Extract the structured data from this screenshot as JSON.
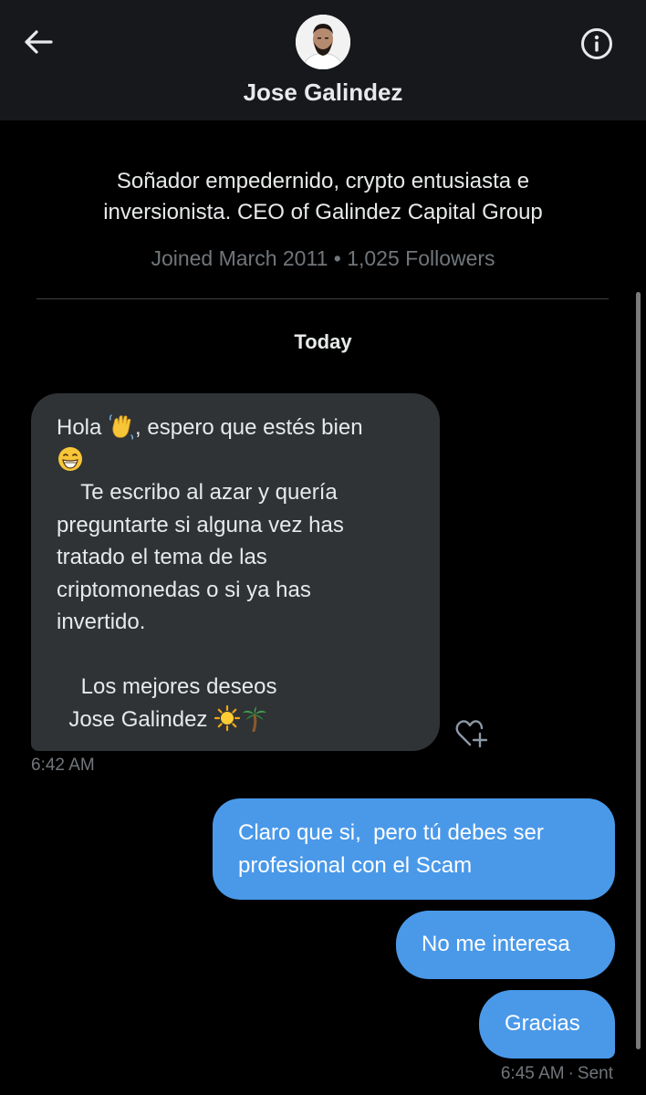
{
  "header": {
    "name": "Jose Galindez",
    "back_icon": "arrow-left-icon",
    "info_icon": "info-circle-icon"
  },
  "profile": {
    "bio_line1": "Soñador empedernido, crypto entusiasta e",
    "bio_line2": "inversionista. CEO of Galindez Capital Group",
    "joined": "Joined March 2011",
    "separator": "•",
    "followers": "1,025 Followers"
  },
  "conversation": {
    "day_label": "Today",
    "received": {
      "line1_a": "Hola ",
      "line1_b": ", espero que estés bien",
      "line3": "    Te escribo al azar y quería",
      "line4": "preguntarte si alguna vez has",
      "line5": "tratado el tema de las",
      "line6": "criptomonedas o si ya has",
      "line7": "invertido.",
      "line9": "    Los mejores deseos",
      "line10": "  Jose Galindez ",
      "time": "6:42 AM",
      "emojis": [
        "waving-hand-emoji",
        "grinning-face-emoji",
        "sun-emoji",
        "palm-tree-emoji"
      ],
      "react_icon": "heart-plus-icon"
    },
    "sent": [
      {
        "line1": "Claro que si,  pero tú debes ser",
        "line2": "profesional con el Scam"
      },
      {
        "text": "No me interesa"
      },
      {
        "text": "Gracias"
      }
    ],
    "sent_time": "6:45 AM",
    "sent_status": "Sent",
    "sent_separator": "·"
  },
  "colors": {
    "background": "#000000",
    "header": "#16181c",
    "received_bubble": "#2f3336",
    "sent_bubble": "#4a99e9",
    "secondary_text": "#71767b"
  }
}
